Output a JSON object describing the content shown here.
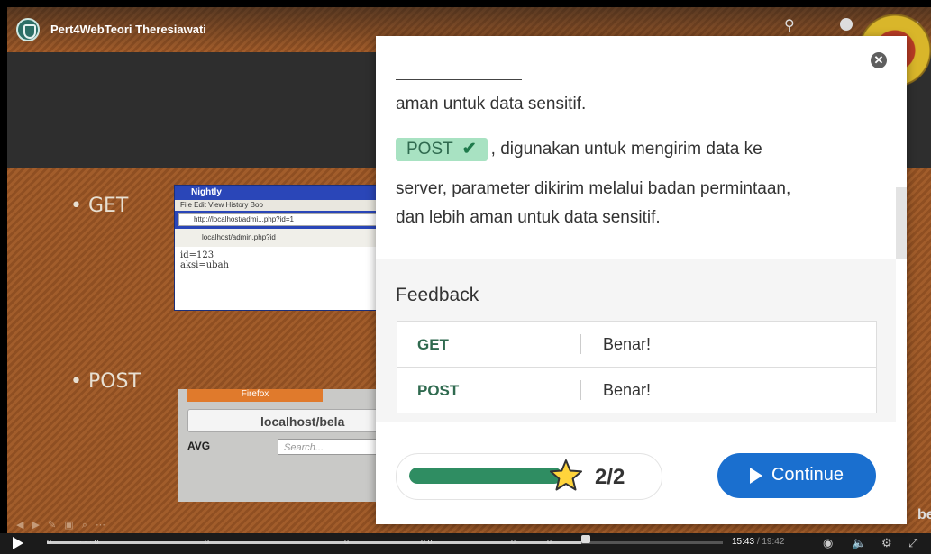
{
  "video": {
    "title": "Pert4WebTeori Theresiawati",
    "slide": {
      "bullet_get": "• GET",
      "bullet_post": "• POST",
      "shot1": {
        "title": "Nightly",
        "menu": "File  Edit  View  History  Boo",
        "address": "http://localhost/admi...php?id=1",
        "nav": "localhost/admin.php?id",
        "body_line1": "id=123",
        "body_line2": "aksi=ubah"
      },
      "shot2": {
        "tab": "Firefox",
        "url": "localhost/bela",
        "avg": "AVG",
        "search_placeholder": "Search..."
      }
    },
    "brand_fragment": "be"
  },
  "player": {
    "current_time": "15:43",
    "duration": "/ 19:42",
    "progress": 0.79
  },
  "modal": {
    "paragraph_top": "aman untuk data sensitif.",
    "answer_chip": "POST",
    "paragraph_mid": ", digunakan untuk mengirim data ke",
    "paragraph_line3": "server, parameter dikirim melalui badan permintaan,",
    "paragraph_line4": "dan lebih aman untuk data sensitif.",
    "feedback_title": "Feedback",
    "feedback": [
      {
        "key": "GET",
        "value": "Benar!"
      },
      {
        "key": "POST",
        "value": "Benar!"
      }
    ],
    "score": "2/2",
    "score_progress": 1.0,
    "continue_label": "Continue"
  }
}
